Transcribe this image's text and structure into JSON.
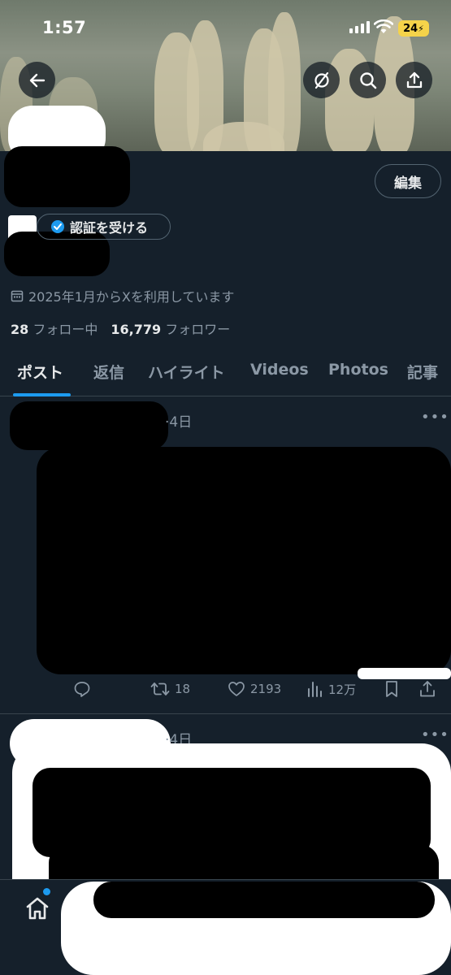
{
  "status": {
    "time": "1:57",
    "battery": "24"
  },
  "header": {
    "back_icon": "arrow-left-icon",
    "icons": [
      "no-notifications-icon",
      "search-icon",
      "share-icon"
    ]
  },
  "profile": {
    "edit_label": "編集",
    "verify_label": "認証を受ける",
    "joined": "2025年1月からXを利用しています",
    "following_count": "28",
    "following_label": "フォロー中",
    "followers_count": "16,779",
    "followers_label": "フォロワー"
  },
  "tabs": [
    {
      "label": "ポスト"
    },
    {
      "label": "返信"
    },
    {
      "label": "ハイライト"
    },
    {
      "label": "Videos"
    },
    {
      "label": "Photos"
    },
    {
      "label": "記事"
    }
  ],
  "posts": [
    {
      "time": "4日",
      "replies": "",
      "reposts": "18",
      "likes": "2193",
      "views": "12万"
    },
    {
      "time": "4日"
    }
  ],
  "colors": {
    "accent": "#1d9bf0",
    "background": "#15202b",
    "muted": "#8b98a5"
  }
}
